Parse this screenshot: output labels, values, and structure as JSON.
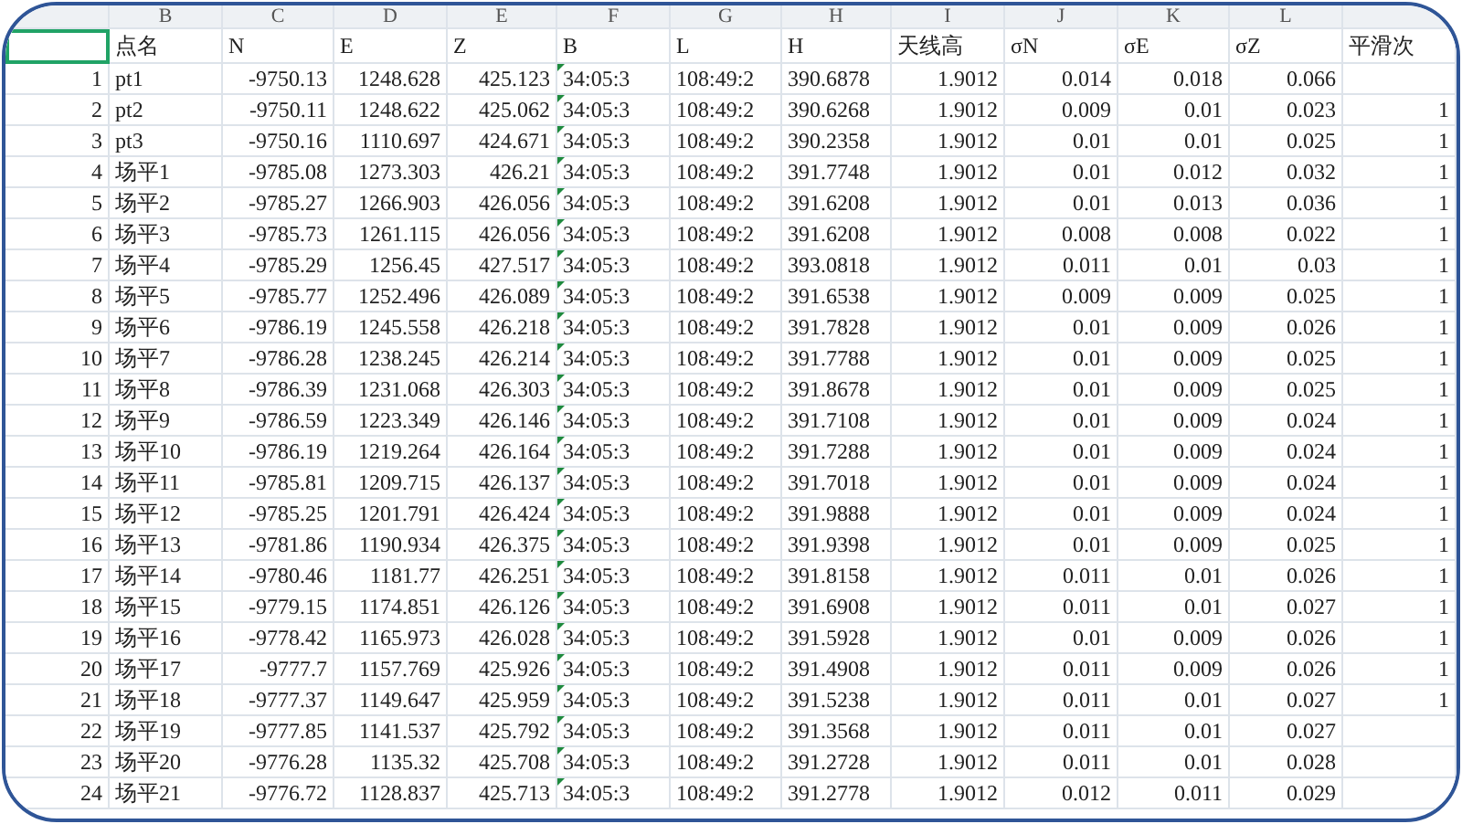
{
  "column_letters": [
    "B",
    "C",
    "D",
    "E",
    "F",
    "G",
    "H",
    "I",
    "J",
    "K",
    "L"
  ],
  "header": {
    "first_cell_selected": true,
    "labels": [
      "点名",
      "N",
      "E",
      "Z",
      "B",
      "L",
      "H",
      "天线高",
      "σN",
      "σE",
      "σZ",
      "平滑次"
    ]
  },
  "rows": [
    {
      "flagged": true,
      "cells": [
        "1",
        "pt1",
        "-9750.13",
        "1248.628",
        "425.123",
        "34:05:3",
        "108:49:2",
        "390.6878",
        "1.9012",
        "0.014",
        "0.018",
        "0.066"
      ]
    },
    {
      "flagged": true,
      "cells": [
        "2",
        "pt2",
        "-9750.11",
        "1248.622",
        "425.062",
        "34:05:3",
        "108:49:2",
        "390.6268",
        "1.9012",
        "0.009",
        "0.01",
        "0.023",
        "1"
      ]
    },
    {
      "flagged": true,
      "cells": [
        "3",
        "pt3",
        "-9750.16",
        "1110.697",
        "424.671",
        "34:05:3",
        "108:49:2",
        "390.2358",
        "1.9012",
        "0.01",
        "0.01",
        "0.025",
        "1"
      ]
    },
    {
      "flagged": true,
      "cells": [
        "4",
        "场平1",
        "-9785.08",
        "1273.303",
        "426.21",
        "34:05:3",
        "108:49:2",
        "391.7748",
        "1.9012",
        "0.01",
        "0.012",
        "0.032",
        "1"
      ]
    },
    {
      "flagged": true,
      "cells": [
        "5",
        "场平2",
        "-9785.27",
        "1266.903",
        "426.056",
        "34:05:3",
        "108:49:2",
        "391.6208",
        "1.9012",
        "0.01",
        "0.013",
        "0.036",
        "1"
      ]
    },
    {
      "flagged": true,
      "cells": [
        "6",
        "场平3",
        "-9785.73",
        "1261.115",
        "426.056",
        "34:05:3",
        "108:49:2",
        "391.6208",
        "1.9012",
        "0.008",
        "0.008",
        "0.022",
        "1"
      ]
    },
    {
      "flagged": true,
      "cells": [
        "7",
        "场平4",
        "-9785.29",
        "1256.45",
        "427.517",
        "34:05:3",
        "108:49:2",
        "393.0818",
        "1.9012",
        "0.011",
        "0.01",
        "0.03",
        "1"
      ]
    },
    {
      "flagged": true,
      "cells": [
        "8",
        "场平5",
        "-9785.77",
        "1252.496",
        "426.089",
        "34:05:3",
        "108:49:2",
        "391.6538",
        "1.9012",
        "0.009",
        "0.009",
        "0.025",
        "1"
      ]
    },
    {
      "flagged": true,
      "cells": [
        "9",
        "场平6",
        "-9786.19",
        "1245.558",
        "426.218",
        "34:05:3",
        "108:49:2",
        "391.7828",
        "1.9012",
        "0.01",
        "0.009",
        "0.026",
        "1"
      ]
    },
    {
      "flagged": true,
      "cells": [
        "10",
        "场平7",
        "-9786.28",
        "1238.245",
        "426.214",
        "34:05:3",
        "108:49:2",
        "391.7788",
        "1.9012",
        "0.01",
        "0.009",
        "0.025",
        "1"
      ]
    },
    {
      "flagged": true,
      "cells": [
        "11",
        "场平8",
        "-9786.39",
        "1231.068",
        "426.303",
        "34:05:3",
        "108:49:2",
        "391.8678",
        "1.9012",
        "0.01",
        "0.009",
        "0.025",
        "1"
      ]
    },
    {
      "flagged": true,
      "cells": [
        "12",
        "场平9",
        "-9786.59",
        "1223.349",
        "426.146",
        "34:05:3",
        "108:49:2",
        "391.7108",
        "1.9012",
        "0.01",
        "0.009",
        "0.024",
        "1"
      ]
    },
    {
      "flagged": true,
      "cells": [
        "13",
        "场平10",
        "-9786.19",
        "1219.264",
        "426.164",
        "34:05:3",
        "108:49:2",
        "391.7288",
        "1.9012",
        "0.01",
        "0.009",
        "0.024",
        "1"
      ]
    },
    {
      "flagged": true,
      "cells": [
        "14",
        "场平11",
        "-9785.81",
        "1209.715",
        "426.137",
        "34:05:3",
        "108:49:2",
        "391.7018",
        "1.9012",
        "0.01",
        "0.009",
        "0.024",
        "1"
      ]
    },
    {
      "flagged": true,
      "cells": [
        "15",
        "场平12",
        "-9785.25",
        "1201.791",
        "426.424",
        "34:05:3",
        "108:49:2",
        "391.9888",
        "1.9012",
        "0.01",
        "0.009",
        "0.024",
        "1"
      ]
    },
    {
      "flagged": true,
      "cells": [
        "16",
        "场平13",
        "-9781.86",
        "1190.934",
        "426.375",
        "34:05:3",
        "108:49:2",
        "391.9398",
        "1.9012",
        "0.01",
        "0.009",
        "0.025",
        "1"
      ]
    },
    {
      "flagged": true,
      "cells": [
        "17",
        "场平14",
        "-9780.46",
        "1181.77",
        "426.251",
        "34:05:3",
        "108:49:2",
        "391.8158",
        "1.9012",
        "0.011",
        "0.01",
        "0.026",
        "1"
      ]
    },
    {
      "flagged": true,
      "cells": [
        "18",
        "场平15",
        "-9779.15",
        "1174.851",
        "426.126",
        "34:05:3",
        "108:49:2",
        "391.6908",
        "1.9012",
        "0.011",
        "0.01",
        "0.027",
        "1"
      ]
    },
    {
      "flagged": true,
      "cells": [
        "19",
        "场平16",
        "-9778.42",
        "1165.973",
        "426.028",
        "34:05:3",
        "108:49:2",
        "391.5928",
        "1.9012",
        "0.01",
        "0.009",
        "0.026",
        "1"
      ]
    },
    {
      "flagged": true,
      "cells": [
        "20",
        "场平17",
        "-9777.7",
        "1157.769",
        "425.926",
        "34:05:3",
        "108:49:2",
        "391.4908",
        "1.9012",
        "0.011",
        "0.009",
        "0.026",
        "1"
      ]
    },
    {
      "flagged": true,
      "cells": [
        "21",
        "场平18",
        "-9777.37",
        "1149.647",
        "425.959",
        "34:05:3",
        "108:49:2",
        "391.5238",
        "1.9012",
        "0.011",
        "0.01",
        "0.027",
        "1"
      ]
    },
    {
      "flagged": true,
      "cells": [
        "22",
        "场平19",
        "-9777.85",
        "1141.537",
        "425.792",
        "34:05:3",
        "108:49:2",
        "391.3568",
        "1.9012",
        "0.011",
        "0.01",
        "0.027"
      ]
    },
    {
      "flagged": true,
      "cells": [
        "23",
        "场平20",
        "-9776.28",
        "1135.32",
        "425.708",
        "34:05:3",
        "108:49:2",
        "391.2728",
        "1.9012",
        "0.011",
        "0.01",
        "0.028"
      ]
    },
    {
      "flagged": true,
      "cells": [
        "24",
        "场平21",
        "-9776.72",
        "1128.837",
        "425.713",
        "34:05:3",
        "108:49:2",
        "391.2778",
        "1.9012",
        "0.012",
        "0.011",
        "0.029"
      ]
    }
  ]
}
